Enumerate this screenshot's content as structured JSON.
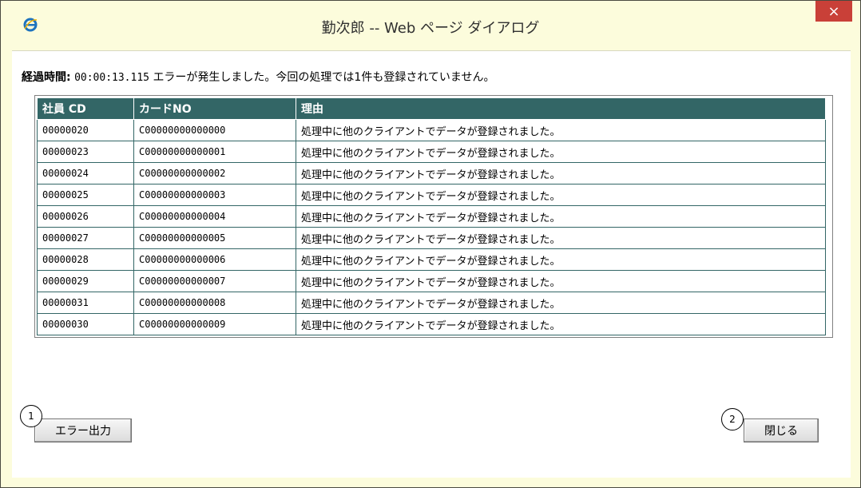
{
  "window": {
    "title": "勤次郎 -- Web ページ ダイアログ",
    "close_glyph": "×",
    "icon": "ie-icon"
  },
  "status": {
    "label": "経過時間:",
    "elapsed": "00:00:13.115",
    "message": "エラーが発生しました。今回の処理では1件も登録されていません。"
  },
  "table": {
    "headers": [
      "社員 CD",
      "カードNO",
      "理由"
    ],
    "rows": [
      [
        "00000020",
        "C00000000000000",
        "処理中に他のクライアントでデータが登録されました。"
      ],
      [
        "00000023",
        "C00000000000001",
        "処理中に他のクライアントでデータが登録されました。"
      ],
      [
        "00000024",
        "C00000000000002",
        "処理中に他のクライアントでデータが登録されました。"
      ],
      [
        "00000025",
        "C00000000000003",
        "処理中に他のクライアントでデータが登録されました。"
      ],
      [
        "00000026",
        "C00000000000004",
        "処理中に他のクライアントでデータが登録されました。"
      ],
      [
        "00000027",
        "C00000000000005",
        "処理中に他のクライアントでデータが登録されました。"
      ],
      [
        "00000028",
        "C00000000000006",
        "処理中に他のクライアントでデータが登録されました。"
      ],
      [
        "00000029",
        "C00000000000007",
        "処理中に他のクライアントでデータが登録されました。"
      ],
      [
        "00000031",
        "C00000000000008",
        "処理中に他のクライアントでデータが登録されました。"
      ],
      [
        "00000030",
        "C00000000000009",
        "処理中に他のクライアントでデータが登録されました。"
      ]
    ]
  },
  "buttons": {
    "error_output": "エラー出力",
    "close": "閉じる"
  },
  "markers": {
    "one": "1",
    "two": "2"
  },
  "colors": {
    "header_bg": "#336666",
    "close_bg": "#c94038",
    "frame": "#fcfcdc"
  }
}
